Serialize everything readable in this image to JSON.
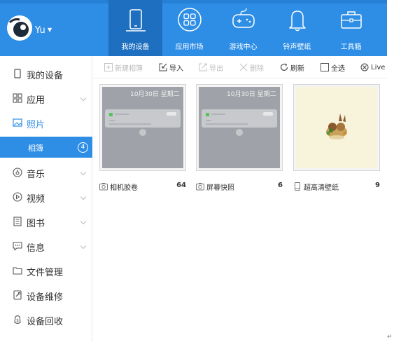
{
  "header": {
    "user": "Yu",
    "nav": [
      {
        "label": "我的设备",
        "icon": "tablet-icon",
        "active": true
      },
      {
        "label": "应用市场",
        "icon": "apps-icon",
        "active": false
      },
      {
        "label": "游戏中心",
        "icon": "gamepad-icon",
        "active": false
      },
      {
        "label": "铃声壁纸",
        "icon": "bell-icon",
        "active": false
      },
      {
        "label": "工具箱",
        "icon": "toolbox-icon",
        "active": false
      }
    ]
  },
  "sidebar": {
    "items": [
      {
        "label": "我的设备",
        "icon": "device-icon",
        "expandable": false
      },
      {
        "label": "应用",
        "icon": "grid-icon",
        "expandable": true
      },
      {
        "label": "照片",
        "icon": "photo-icon",
        "expandable": false,
        "highlight": true
      },
      {
        "label": "音乐",
        "icon": "music-icon",
        "expandable": true
      },
      {
        "label": "视频",
        "icon": "video-icon",
        "expandable": true
      },
      {
        "label": "图书",
        "icon": "book-icon",
        "expandable": true
      },
      {
        "label": "信息",
        "icon": "message-icon",
        "expandable": true
      },
      {
        "label": "文件管理",
        "icon": "folder-icon",
        "expandable": false
      },
      {
        "label": "设备维修",
        "icon": "repair-icon",
        "expandable": false
      },
      {
        "label": "设备回收",
        "icon": "recycle-icon",
        "expandable": false
      }
    ],
    "sub": {
      "label": "相簿",
      "count": "4"
    }
  },
  "toolbar": {
    "new_album": "新建相簿",
    "import": "导入",
    "export": "导出",
    "delete": "删除",
    "refresh": "刷新",
    "select_all": "全选",
    "live": "Live"
  },
  "albums": [
    {
      "name": "相机胶卷",
      "count": "64",
      "icon": "camera-icon",
      "date": "10月30日 星期二"
    },
    {
      "name": "屏幕快照",
      "count": "6",
      "icon": "camera-icon",
      "date": "10月30日 星期二"
    },
    {
      "name": "超高清壁纸",
      "count": "9",
      "icon": "phone-icon"
    }
  ],
  "misc": {
    "return_mark": "↵"
  },
  "colors": {
    "accent": "#2e8ee6",
    "nav_active": "#1f6fc0"
  }
}
